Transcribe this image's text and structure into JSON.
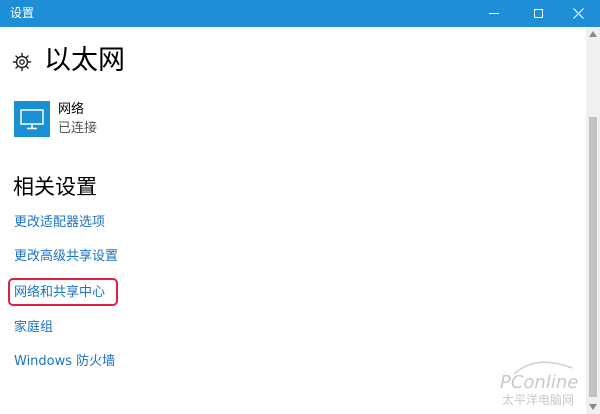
{
  "window": {
    "title": "设置"
  },
  "page": {
    "title": "以太网"
  },
  "network": {
    "name": "网络",
    "status": "已连接"
  },
  "related": {
    "title": "相关设置",
    "links": [
      "更改适配器选项",
      "更改高级共享设置",
      "网络和共享中心",
      "家庭组",
      "Windows 防火墙"
    ]
  },
  "watermark": {
    "brand": "PConline",
    "sub": "太平洋电脑网"
  },
  "colors": {
    "titlebar": "#1e8fd6",
    "accent_link": "#1a73c6",
    "network_icon_bg": "#1a8fd3",
    "highlight_box": "#e02040"
  },
  "icons": {
    "settings": "gear-icon",
    "network": "monitor-icon",
    "minimize": "minimize-icon",
    "maximize": "maximize-icon",
    "close": "close-icon"
  }
}
